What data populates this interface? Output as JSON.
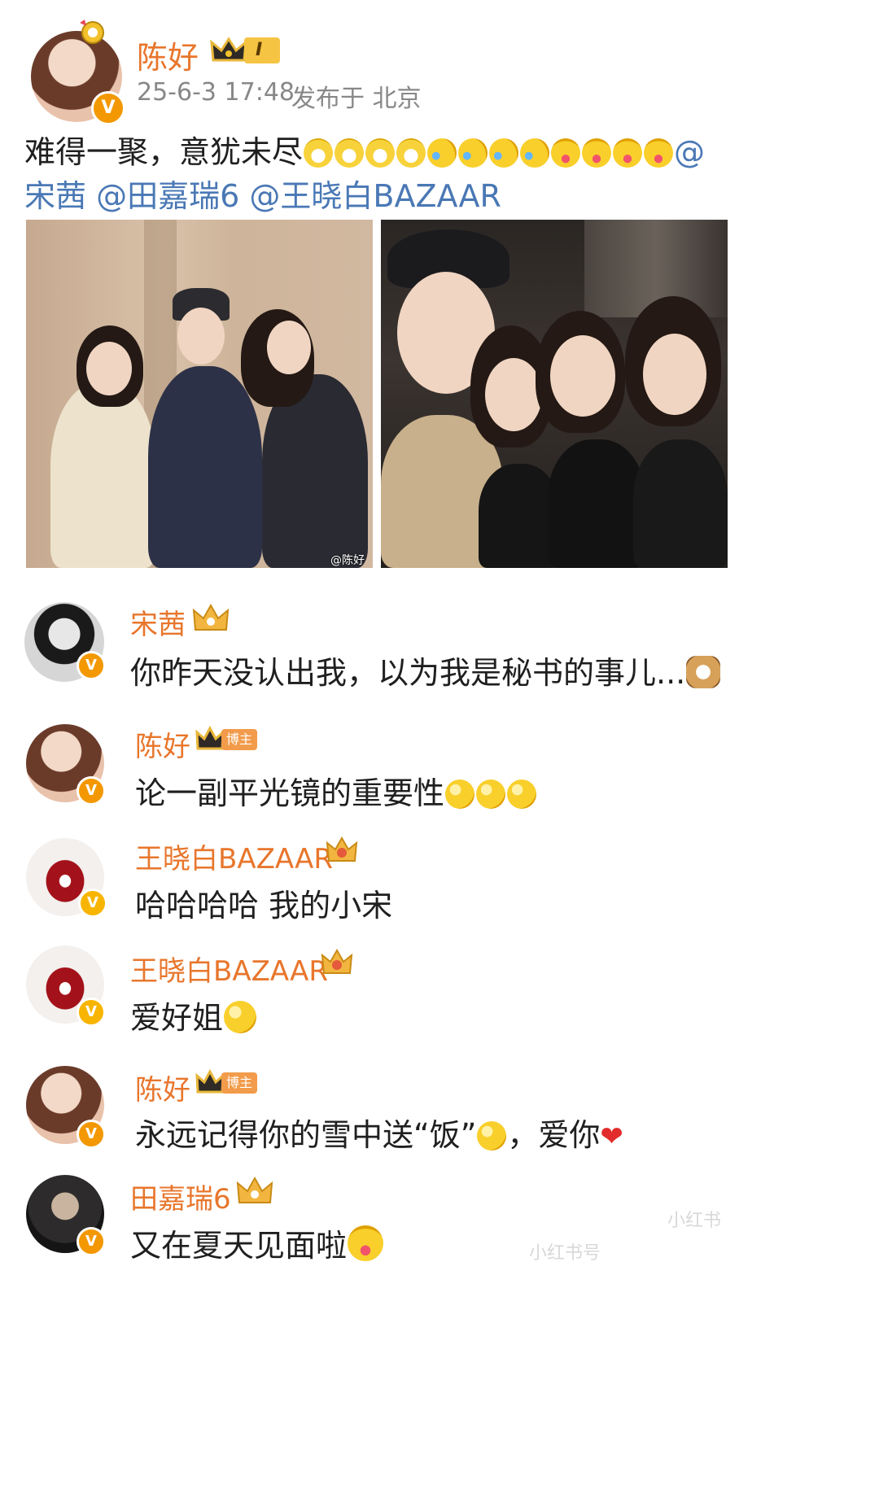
{
  "post": {
    "author": "陈好",
    "level": "I",
    "timestamp": "25-6-3 17:48",
    "location": "发布于 北京",
    "text_main": "难得一聚，意犹未尽",
    "emoji_trailing_at": "@",
    "mentions": [
      "宋茜",
      "@田嘉瑞6",
      "@王晓白BAZAAR"
    ],
    "photo_watermark": "@陈好"
  },
  "comments": [
    {
      "author": "宋茜",
      "text": "你昨天没认出我，以为我是秘书的事儿...",
      "emoji": "cat-icon"
    },
    {
      "author": "陈好",
      "badge": "博主",
      "text": "论一副平光镜的重要性",
      "emoji": "glasses-face-icon"
    },
    {
      "author": "王晓白BAZAAR",
      "text": "哈哈哈哈 我的小宋"
    },
    {
      "author": "王晓白BAZAAR",
      "text": "爱好姐",
      "emoji": "kiss-face-icon"
    },
    {
      "author": "陈好",
      "badge": "博主",
      "text": "永远记得你的雪中送“饭”",
      "text_tail": "，爱你",
      "emoji": "thinking-face-icon"
    },
    {
      "author": "田嘉瑞6",
      "text": "又在夏天见面啦",
      "emoji": "tongue-face-icon"
    }
  ],
  "watermark": {
    "corner": "小红书",
    "bottom": "小红书号"
  },
  "colors": {
    "name": "#e8762c",
    "mention": "#4a78b5",
    "verify": "#f39800"
  }
}
